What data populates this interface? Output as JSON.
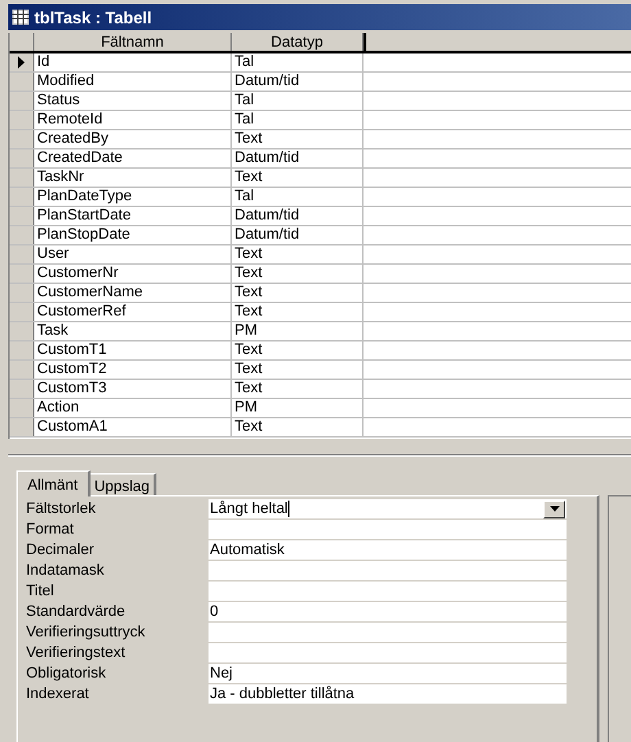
{
  "window": {
    "title": "tblTask : Tabell"
  },
  "table": {
    "columns": [
      "Fältnamn",
      "Datatyp"
    ],
    "rows": [
      {
        "name": "Id",
        "type": "Tal",
        "selected": true
      },
      {
        "name": "Modified",
        "type": "Datum/tid",
        "selected": false
      },
      {
        "name": "Status",
        "type": "Tal",
        "selected": false
      },
      {
        "name": "RemoteId",
        "type": "Tal",
        "selected": false
      },
      {
        "name": "CreatedBy",
        "type": "Text",
        "selected": false
      },
      {
        "name": "CreatedDate",
        "type": "Datum/tid",
        "selected": false
      },
      {
        "name": "TaskNr",
        "type": "Text",
        "selected": false
      },
      {
        "name": "PlanDateType",
        "type": "Tal",
        "selected": false
      },
      {
        "name": "PlanStartDate",
        "type": "Datum/tid",
        "selected": false
      },
      {
        "name": "PlanStopDate",
        "type": "Datum/tid",
        "selected": false
      },
      {
        "name": "User",
        "type": "Text",
        "selected": false
      },
      {
        "name": "CustomerNr",
        "type": "Text",
        "selected": false
      },
      {
        "name": "CustomerName",
        "type": "Text",
        "selected": false
      },
      {
        "name": "CustomerRef",
        "type": "Text",
        "selected": false
      },
      {
        "name": "Task",
        "type": "PM",
        "selected": false
      },
      {
        "name": "CustomT1",
        "type": "Text",
        "selected": false
      },
      {
        "name": "CustomT2",
        "type": "Text",
        "selected": false
      },
      {
        "name": "CustomT3",
        "type": "Text",
        "selected": false
      },
      {
        "name": "Action",
        "type": "PM",
        "selected": false
      },
      {
        "name": "CustomA1",
        "type": "Text",
        "selected": false
      }
    ]
  },
  "tabs": [
    {
      "label": "Allmänt",
      "selected": true
    },
    {
      "label": "Uppslag",
      "selected": false
    }
  ],
  "properties": [
    {
      "label": "Fältstorlek",
      "value": "Långt heltal",
      "kind": "dropdown"
    },
    {
      "label": "Format",
      "kind": "text"
    },
    {
      "label": "Decimaler",
      "value": "Automatisk",
      "kind": "text"
    },
    {
      "label": "Indatamask",
      "kind": "text"
    },
    {
      "label": "Titel",
      "kind": "text"
    },
    {
      "label": "Standardvärde",
      "value": "0",
      "kind": "text"
    },
    {
      "label": "Verifieringsuttryck",
      "kind": "text"
    },
    {
      "label": "Verifieringstext",
      "kind": "text"
    },
    {
      "label": "Obligatorisk",
      "value": "Nej",
      "kind": "text"
    },
    {
      "label": "Indexerat",
      "value": "Ja - dubbletter tillåtna",
      "kind": "text"
    }
  ]
}
